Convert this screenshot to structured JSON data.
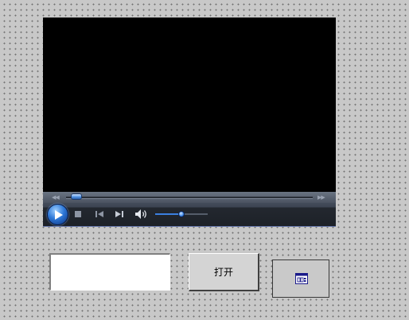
{
  "player": {
    "seek_position_fraction": 0.02,
    "volume_fraction": 0.5,
    "icons": {
      "play": "play-icon",
      "stop": "stop-icon",
      "previous": "previous-icon",
      "next": "next-icon",
      "volume": "speaker-icon",
      "rewind": "rewind-icon",
      "fast_forward": "fast-forward-icon"
    },
    "colors": {
      "screen": "#000000",
      "accent": "#3b7fe0"
    }
  },
  "form": {
    "input_value": "",
    "open_button_label": "打开",
    "control_icon": "activex-control-icon"
  }
}
